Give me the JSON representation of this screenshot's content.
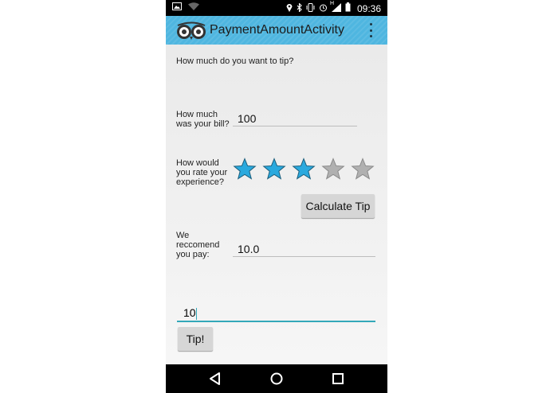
{
  "status_bar": {
    "time": "09:36",
    "left_icons": [
      "image-icon",
      "wifi-question-icon"
    ],
    "right_icons": [
      "location-icon",
      "bluetooth-icon",
      "vibrate-icon",
      "alarm-icon",
      "signal-h-icon",
      "battery-icon"
    ],
    "network_label": "H"
  },
  "action_bar": {
    "title": "PaymentAmountActivity",
    "bg_color": "#4fb6e0"
  },
  "form": {
    "heading": "How much do you want to tip?",
    "bill_label_line1": "How much",
    "bill_label_line2": "was your bill?",
    "bill_value": "100",
    "rate_label_line1": "How would",
    "rate_label_line2": "you rate your",
    "rate_label_line3": "experience?",
    "rating": 3,
    "rating_max": 5,
    "star_on_color": "#2aa9de",
    "star_off_color": "#b0b0b0",
    "calculate_label": "Calculate Tip",
    "recommend_line1": "We",
    "recommend_line2": "reccomend",
    "recommend_line3": "you pay:",
    "recommend_value": "10.0",
    "tip_value": "10",
    "tip_button_label": "Tip!"
  },
  "nav_bar": {
    "icons": [
      "back-icon",
      "home-icon",
      "recents-icon"
    ]
  }
}
